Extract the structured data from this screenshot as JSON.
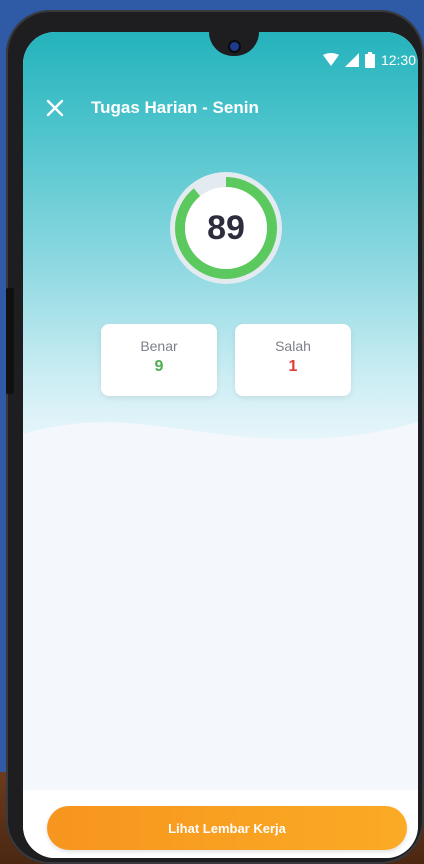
{
  "status_bar": {
    "time": "12:30",
    "wifi_icon": "wifi-icon",
    "signal_icon": "signal-icon",
    "battery_icon": "battery-icon"
  },
  "header": {
    "title": "Tugas Harian - Senin",
    "close_icon": "close-icon"
  },
  "score": {
    "value": "89",
    "progress_fraction": 0.89,
    "progress_color": "#5cc95e",
    "track_color": "#e3ebf1"
  },
  "stats": {
    "correct": {
      "label": "Benar",
      "value": "9",
      "color": "#4caf50"
    },
    "wrong": {
      "label": "Salah",
      "value": "1",
      "color": "#e53935"
    }
  },
  "footer": {
    "button_label": "Lihat Lembar Kerja",
    "button_color": "#f7951e"
  }
}
